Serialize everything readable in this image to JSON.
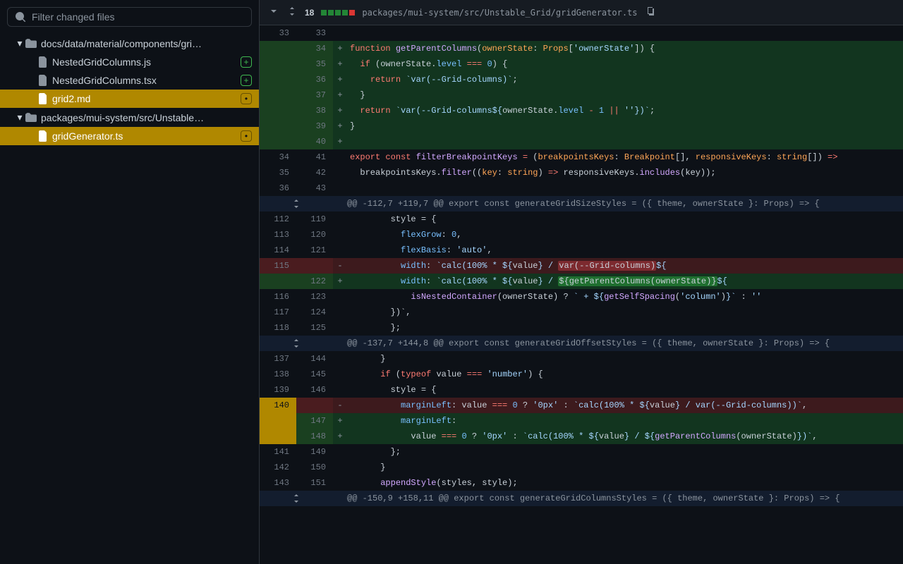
{
  "filter_placeholder": "Filter changed files",
  "tree": {
    "folder1": "docs/data/material/components/gri…",
    "f1": "NestedGridColumns.js",
    "f2": "NestedGridColumns.tsx",
    "f3": "grid2.md",
    "folder2": "packages/mui-system/src/Unstable…",
    "f4": "gridGenerator.ts"
  },
  "header": {
    "count": "18",
    "path": "packages/mui-system/src/Unstable_Grid/gridGenerator.ts"
  },
  "hunks": {
    "h1": "@@ -112,7 +119,7 @@ export const generateGridSizeStyles = ({ theme, ownerState }: Props) => {",
    "h2": "@@ -137,7 +144,8 @@ export const generateGridOffsetStyles = ({ theme, ownerState }: Props) => {",
    "h3": "@@ -150,9 +158,11 @@ export const generateGridColumnsStyles = ({ theme, ownerState }: Props) => {"
  },
  "ln": {
    "a33": "33",
    "b33": "33",
    "b34": "34",
    "b35": "35",
    "b36": "36",
    "b37": "37",
    "b38": "38",
    "b39": "39",
    "b40": "40",
    "a34": "34",
    "b41": "41",
    "a35": "35",
    "b42": "42",
    "a36": "36",
    "b43": "43",
    "a112": "112",
    "b119": "119",
    "a113": "113",
    "b120": "120",
    "a114": "114",
    "b121": "121",
    "a115": "115",
    "b122": "122",
    "a116": "116",
    "b123": "123",
    "a117": "117",
    "b124": "124",
    "a118": "118",
    "b125": "125",
    "a137": "137",
    "b144": "144",
    "a138": "138",
    "b145": "145",
    "a139": "139",
    "b146": "146",
    "a140": "140",
    "b147": "147",
    "b148": "148",
    "a141": "141",
    "b149": "149",
    "a142": "142",
    "b150": "150",
    "a143": "143",
    "b151": "151"
  },
  "code_plain": {
    "indent6": "      ",
    "style_open": "        style = {",
    "flexgrow": "          flexGrow: ",
    "flexgrow_v": "0",
    "flexbasis": "          flexBasis: ",
    "flexbasis_v": "'auto'",
    "nested": "          isNestedContainer(ownerState) ? ` + ${getSelfSpacing('column')}` : ''",
    "close_tpl": "        })`,",
    "close_brace": "      };",
    "brace_close": "      }",
    "typeofnum": "      if (typeof value === 'number') {",
    "style_open2": "        style = {",
    "objclose": "        };",
    "close7": "      }",
    "append": "      appendStyle(styles, style);"
  }
}
